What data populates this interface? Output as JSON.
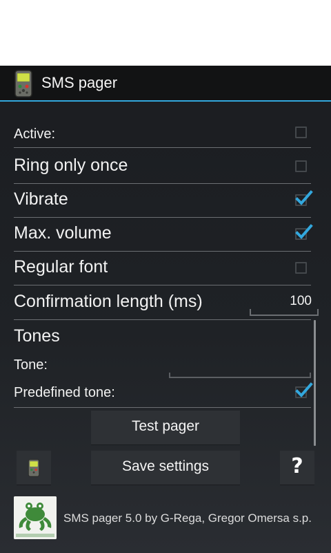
{
  "action_bar": {
    "title": "SMS pager",
    "app_icon": "pager-icon"
  },
  "settings": {
    "active": {
      "label": "Active:",
      "checked": false
    },
    "ring_only_once": {
      "label": "Ring only once",
      "checked": false
    },
    "vibrate": {
      "label": "Vibrate",
      "checked": true
    },
    "max_volume": {
      "label": "Max. volume",
      "checked": true
    },
    "regular_font": {
      "label": "Regular font",
      "checked": false
    },
    "confirmation_length": {
      "label": "Confirmation length (ms)",
      "value": "100"
    },
    "tones": {
      "heading": "Tones",
      "tone_label": "Tone:",
      "tone_value": "",
      "predefined_tone": {
        "label": "Predefined tone:",
        "checked": true
      }
    }
  },
  "buttons": {
    "test_pager": "Test pager",
    "save_settings": "Save settings",
    "pager_icon": "pager-icon",
    "help": "?"
  },
  "footer": {
    "text": "SMS pager 5.0 by G-Rega, Gregor Omersa s.p.",
    "logo": "frog-logo"
  },
  "colors": {
    "accent": "#33a8de",
    "background": "#1f2226",
    "action_bar": "#121314",
    "button": "#2e3135",
    "divider": "#6c6f73"
  }
}
